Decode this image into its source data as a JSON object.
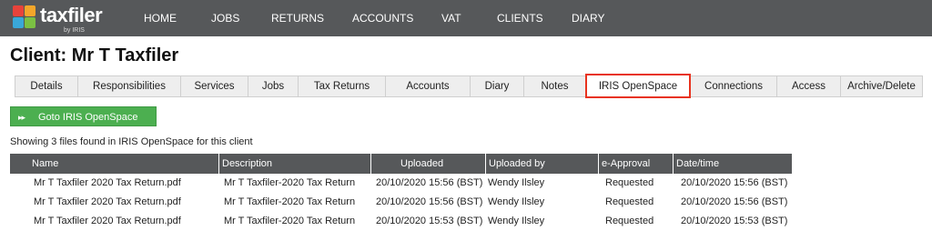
{
  "brand": {
    "name": "taxfiler",
    "sub": "by IRIS"
  },
  "nav": [
    "HOME",
    "JOBS",
    "RETURNS",
    "ACCOUNTS",
    "VAT",
    "CLIENTS",
    "DIARY"
  ],
  "page_title": "Client: Mr T Taxfiler",
  "tabs": [
    {
      "label": "Details",
      "active": false
    },
    {
      "label": "Responsibilities",
      "active": false
    },
    {
      "label": "Services",
      "active": false
    },
    {
      "label": "Jobs",
      "active": false
    },
    {
      "label": "Tax Returns",
      "active": false
    },
    {
      "label": "Accounts",
      "active": false
    },
    {
      "label": "Diary",
      "active": false
    },
    {
      "label": "Notes",
      "active": false
    },
    {
      "label": "IRIS OpenSpace",
      "active": true
    },
    {
      "label": "Connections",
      "active": false
    },
    {
      "label": "Access",
      "active": false
    },
    {
      "label": "Archive/Delete",
      "active": false
    }
  ],
  "goto_button": {
    "label": "Goto IRIS OpenSpace",
    "icon": "forward-icon"
  },
  "summary": "Showing 3 files found in IRIS OpenSpace for this client",
  "table": {
    "columns": [
      "Name",
      "Description",
      "Uploaded",
      "Uploaded by",
      "e-Approval",
      "Date/time"
    ],
    "rows": [
      {
        "name": "Mr T Taxfiler 2020 Tax Return.pdf",
        "description": "Mr T Taxfiler-2020 Tax Return",
        "uploaded": "20/10/2020 15:56 (BST)",
        "uploaded_by": "Wendy Ilsley",
        "approval": "Requested",
        "datetime": "20/10/2020 15:56 (BST)"
      },
      {
        "name": "Mr T Taxfiler 2020 Tax Return.pdf",
        "description": "Mr T Taxfiler-2020 Tax Return",
        "uploaded": "20/10/2020 15:56 (BST)",
        "uploaded_by": "Wendy Ilsley",
        "approval": "Requested",
        "datetime": "20/10/2020 15:56 (BST)"
      },
      {
        "name": "Mr T Taxfiler 2020 Tax Return.pdf",
        "description": "Mr T Taxfiler-2020 Tax Return",
        "uploaded": "20/10/2020 15:53 (BST)",
        "uploaded_by": "Wendy Ilsley",
        "approval": "Requested",
        "datetime": "20/10/2020 15:53 (BST)"
      }
    ]
  },
  "colors": {
    "nav_bg": "#56585a",
    "accent_green": "#4caf50",
    "active_tab_border": "#e8321e"
  }
}
